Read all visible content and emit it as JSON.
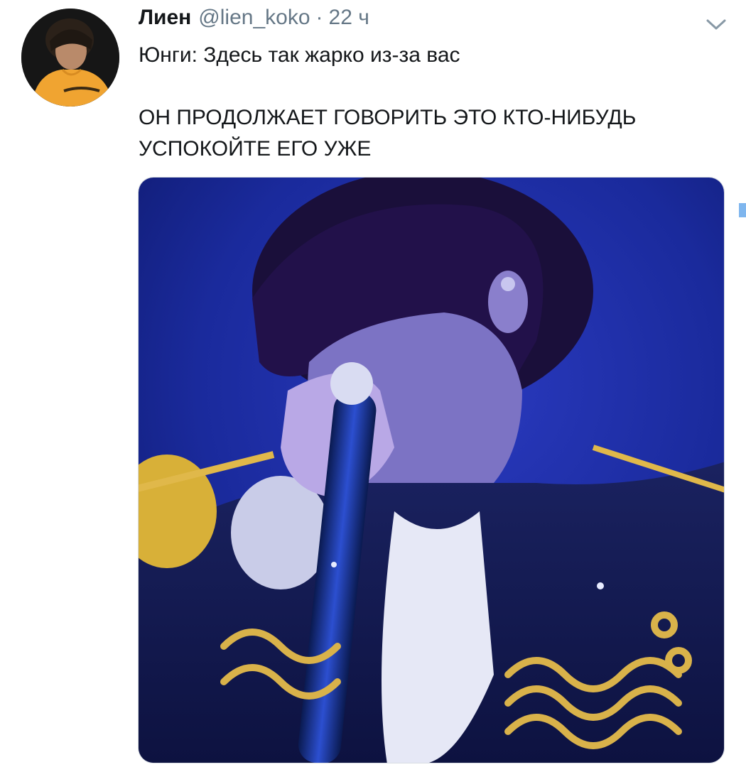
{
  "tweet": {
    "display_name": "Лиен",
    "handle": "@lien_koko",
    "separator": "·",
    "timestamp": "22 ч",
    "text_line_1": "Юнги: Здесь так жарко из-за вас",
    "text_line_2": "ОН ПРОДОЛЖАЕТ ГОВОРИТЬ ЭТО КТО-НИБУДЬ",
    "text_line_3": "УСПОКОЙТЕ ЕГО УЖЕ",
    "menu_icon": "chevron-down-icon",
    "avatar_icon": "profile-photo",
    "media": "performer-photo"
  },
  "colors": {
    "text": "#14171a",
    "secondary": "#657786",
    "stage_blue": "#1c2fa8",
    "accent_edge": "#7fb6ee"
  }
}
